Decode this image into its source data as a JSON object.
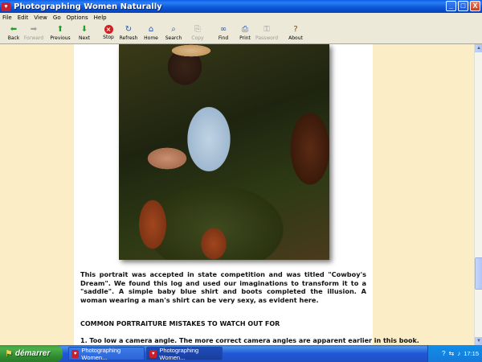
{
  "window": {
    "title": "Photographing Women Naturally",
    "controls": {
      "minimize": "_",
      "maximize": "□",
      "close": "X"
    }
  },
  "menu": [
    "File",
    "Edit",
    "View",
    "Go",
    "Options",
    "Help"
  ],
  "toolbar": [
    {
      "label": "Back",
      "icon": "arrow-left-icon",
      "glyph": "⬅",
      "enabled": true,
      "color": "green"
    },
    {
      "label": "Forward",
      "icon": "arrow-right-icon",
      "glyph": "➡",
      "enabled": false,
      "color": "grey"
    },
    {
      "label": "Previous",
      "icon": "arrow-up-icon",
      "glyph": "⬆",
      "enabled": true,
      "color": "green"
    },
    {
      "label": "Next",
      "icon": "arrow-down-icon",
      "glyph": "⬇",
      "enabled": true,
      "color": "green"
    },
    {
      "label": "Stop",
      "icon": "stop-icon",
      "glyph": "×",
      "enabled": true,
      "color": "red"
    },
    {
      "label": "Refresh",
      "icon": "refresh-icon",
      "glyph": "↻",
      "enabled": true,
      "color": "blue"
    },
    {
      "label": "Home",
      "icon": "home-icon",
      "glyph": "⌂",
      "enabled": true,
      "color": "blue"
    },
    {
      "label": "Search",
      "icon": "search-icon",
      "glyph": "⌕",
      "enabled": true,
      "color": "blue"
    },
    {
      "label": "Copy",
      "icon": "copy-icon",
      "glyph": "⎘",
      "enabled": false,
      "color": "grey"
    },
    {
      "label": "Find",
      "icon": "binoculars-icon",
      "glyph": "∞",
      "enabled": true,
      "color": "blue"
    },
    {
      "label": "Print",
      "icon": "print-icon",
      "glyph": "⎙",
      "enabled": true,
      "color": "blue"
    },
    {
      "label": "Password",
      "icon": "key-icon",
      "glyph": "⚿",
      "enabled": false,
      "color": "grey"
    },
    {
      "label": "About",
      "icon": "about-icon",
      "glyph": "?",
      "enabled": true,
      "color": "brown"
    }
  ],
  "content": {
    "caption": "This portrait was accepted in state competition and was titled \"Cowboy's Dream\". We found this log and used our imaginations to transform it to a \"saddle\". A simple baby blue shirt and boots completed the illusion. A woman wearing a man's shirt can be very sexy, as evident here.",
    "section_heading": "COMMON PORTRAITURE MISTAKES TO WATCH OUT FOR",
    "tip_1": "1. Too low a camera angle. The more correct camera angles are apparent earlier in this book."
  },
  "taskbar": {
    "start_label": "démarrer",
    "items": [
      {
        "label": "Photographing Women...",
        "active": false
      },
      {
        "label": "Photographing Women...",
        "active": true
      }
    ],
    "language": "FR",
    "clock": "17:15"
  },
  "colors": {
    "page_background": "#FBEDC6",
    "titlebar": "#0B56D6",
    "start_button": "#3C9A3C"
  }
}
